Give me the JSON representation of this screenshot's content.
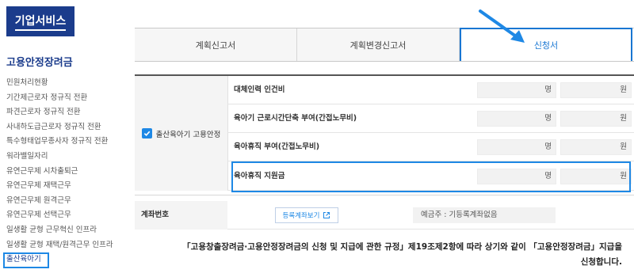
{
  "sidebar": {
    "brand": "기업서비스",
    "title": "고용안정장려금",
    "items": [
      {
        "label": "민원처리현황"
      },
      {
        "label": "기간제근로자 정규직 전환"
      },
      {
        "label": "파견근로자 정규직 전환"
      },
      {
        "label": "사내하도급근로자 정규직 전환"
      },
      {
        "label": "특수형태업무종사자 정규직 전환"
      },
      {
        "label": "워라밸일자리"
      },
      {
        "label": "유연근무제 시차출퇴근"
      },
      {
        "label": "유연근무제 재택근무"
      },
      {
        "label": "유연근무제 원격근무"
      },
      {
        "label": "유연근무제 선택근무"
      },
      {
        "label": "일생활 균형 근무혁신 인프라"
      },
      {
        "label": "일생활 균형 재택/원격근무 인프라"
      },
      {
        "label": "출산육아기"
      }
    ],
    "active_index": 12
  },
  "tabs": [
    {
      "label": "계획신고서"
    },
    {
      "label": "계획변경신고서"
    },
    {
      "label": "신청서"
    }
  ],
  "active_tab": 2,
  "form": {
    "category": "출산육아기 고용안정",
    "category_checked": true,
    "rows": [
      {
        "label": "대체인력 인건비",
        "count_unit": "명",
        "amount_unit": "원"
      },
      {
        "label": "육아기 근로시간단축 부여(간접노무비)",
        "count_unit": "명",
        "amount_unit": "원"
      },
      {
        "label": "육아휴직 부여(간접노무비)",
        "count_unit": "명",
        "amount_unit": "원"
      },
      {
        "label": "육아휴직 지원금",
        "count_unit": "명",
        "amount_unit": "원"
      }
    ],
    "highlighted_row": 3,
    "account": {
      "label": "계좌번호",
      "button": "등록계좌보기",
      "holder": "예금주 : 기등록계좌없음"
    }
  },
  "notice": {
    "line1": "「고용창출장려금·고용안정장려금의 신청 및 지급에 관한 규정」제19조제2항에 따라 상기와 같이 「고용안정장려금」지급을",
    "line2": "신청합니다."
  },
  "colors": {
    "brand": "#1b3c8c",
    "accent": "#1e88e5"
  }
}
